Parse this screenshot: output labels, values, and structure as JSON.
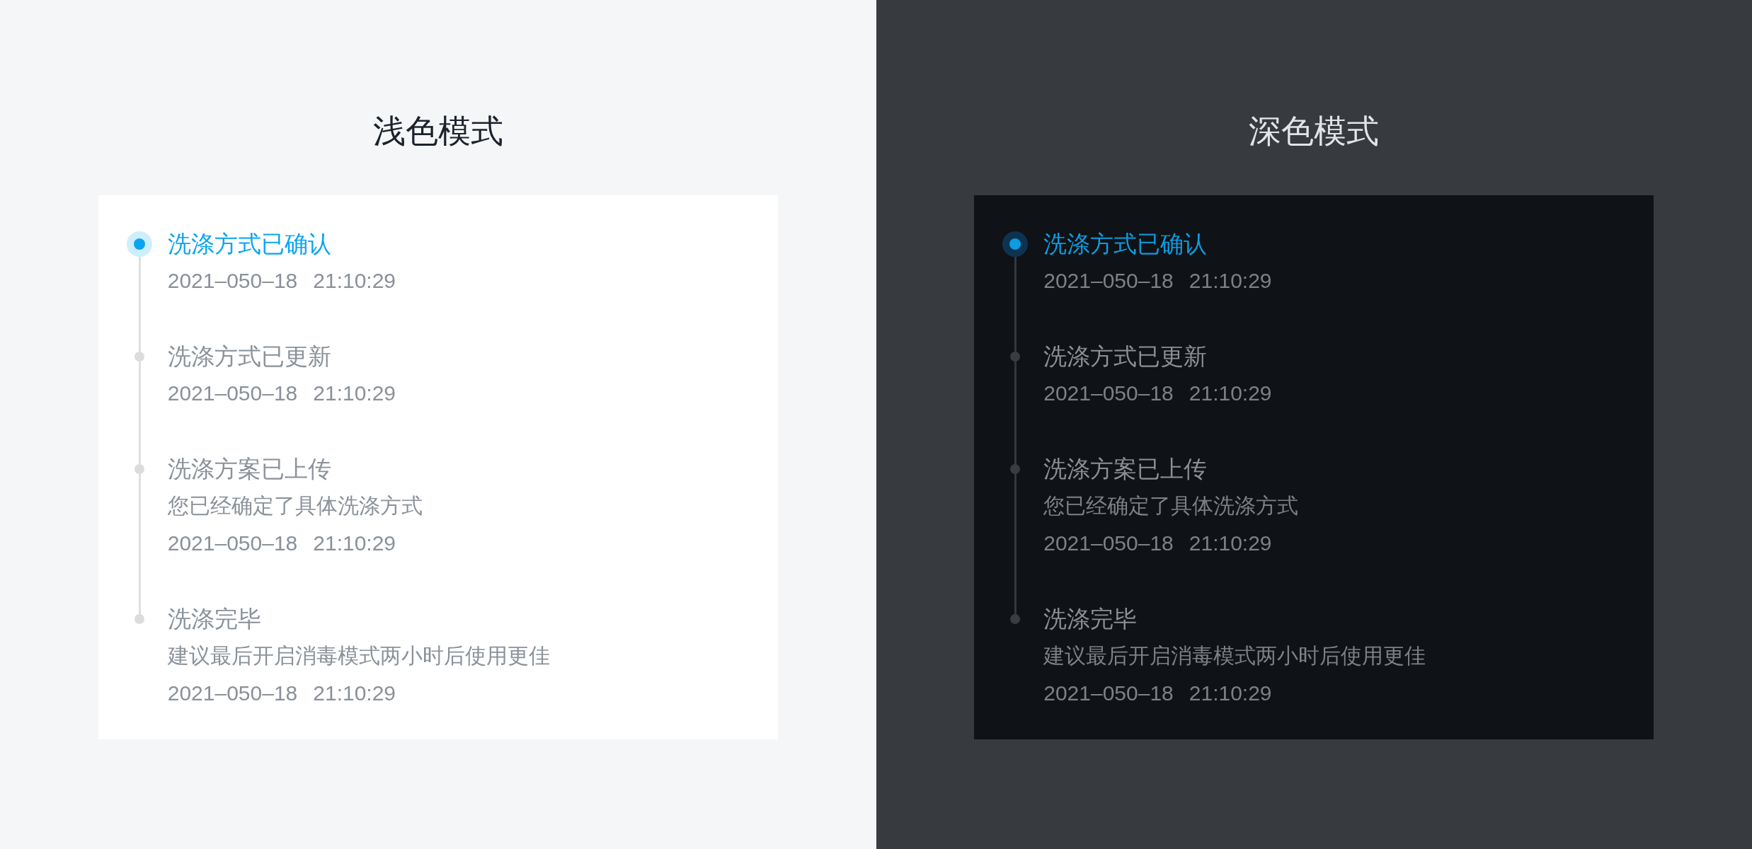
{
  "panels": [
    {
      "kind": "light",
      "title": "浅色模式",
      "timeline": [
        {
          "title": "洗涤方式已确认",
          "date": "2021–050–18",
          "time": "21:10:29",
          "selected": true
        },
        {
          "title": "洗涤方式已更新",
          "date": "2021–050–18",
          "time": "21:10:29",
          "selected": false
        },
        {
          "title": "洗涤方案已上传",
          "description": "您已经确定了具体洗涤方式",
          "date": "2021–050–18",
          "time": "21:10:29",
          "selected": false
        },
        {
          "title": "洗涤完毕",
          "description": "建议最后开启消毒模式两小时后使用更佳",
          "date": "2021–050–18",
          "time": "21:10:29",
          "selected": false
        }
      ]
    },
    {
      "kind": "dark",
      "title": "深色模式",
      "timeline": [
        {
          "title": "洗涤方式已确认",
          "date": "2021–050–18",
          "time": "21:10:29",
          "selected": true
        },
        {
          "title": "洗涤方式已更新",
          "date": "2021–050–18",
          "time": "21:10:29",
          "selected": false
        },
        {
          "title": "洗涤方案已上传",
          "description": "您已经确定了具体洗涤方式",
          "date": "2021–050–18",
          "time": "21:10:29",
          "selected": false
        },
        {
          "title": "洗涤完毕",
          "description": "建议最后开启消毒模式两小时后使用更佳",
          "date": "2021–050–18",
          "time": "21:10:29",
          "selected": false
        }
      ]
    }
  ]
}
